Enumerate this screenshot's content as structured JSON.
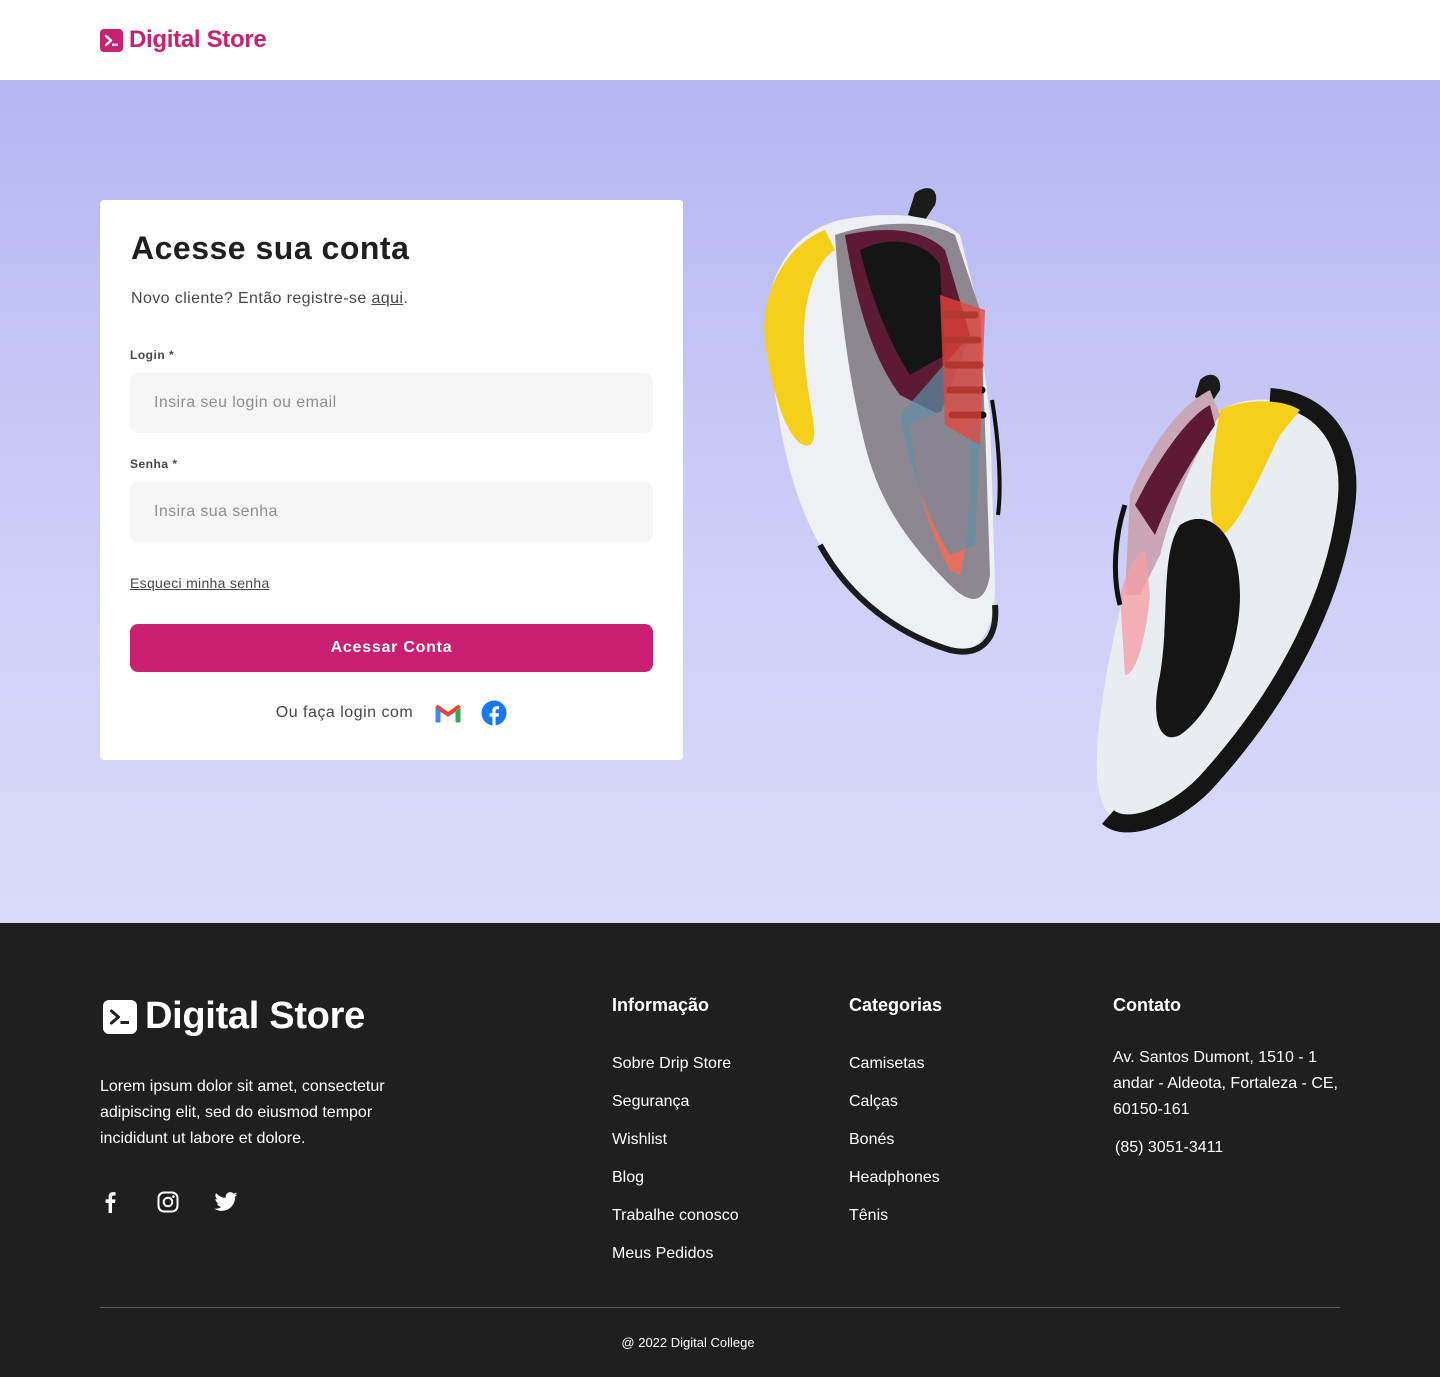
{
  "header": {
    "logo_text": "Digital Store",
    "brand_color": "#C92071"
  },
  "login": {
    "title": "Acesse sua conta",
    "subtitle_prefix": "Novo cliente? Então registre-se ",
    "subtitle_link": "aqui",
    "subtitle_suffix": ".",
    "login_label": "Login *",
    "login_placeholder": "Insira seu login ou email",
    "password_label": "Senha *",
    "password_placeholder": "Insira sua senha",
    "forgot_link": "Esqueci minha senha",
    "submit_label": "Acessar Conta",
    "social_text": "Ou faça login com",
    "social_icons": [
      "gmail-icon",
      "facebook-icon"
    ]
  },
  "hero": {
    "image": "sneakers-pair"
  },
  "footer": {
    "logo_text": "Digital Store",
    "description": "Lorem ipsum dolor sit amet, consectetur adipiscing elit, sed do eiusmod tempor incididunt ut labore et dolore.",
    "social_icons": [
      "facebook-icon",
      "instagram-icon",
      "twitter-icon"
    ],
    "info": {
      "title": "Informação",
      "items": [
        "Sobre Drip Store",
        "Segurança",
        "Wishlist",
        "Blog",
        "Trabalhe conosco",
        "Meus Pedidos"
      ]
    },
    "categories": {
      "title": "Categorias",
      "items": [
        "Camisetas",
        "Calças",
        "Bonés",
        "Headphones",
        "Tênis"
      ]
    },
    "contact": {
      "title": "Contato",
      "address": "Av. Santos Dumont, 1510 - 1 andar - Aldeota, Fortaleza - CE, 60150-161",
      "phone": "(85) 3051-3411"
    },
    "copyright": "@ 2022 Digital College"
  }
}
